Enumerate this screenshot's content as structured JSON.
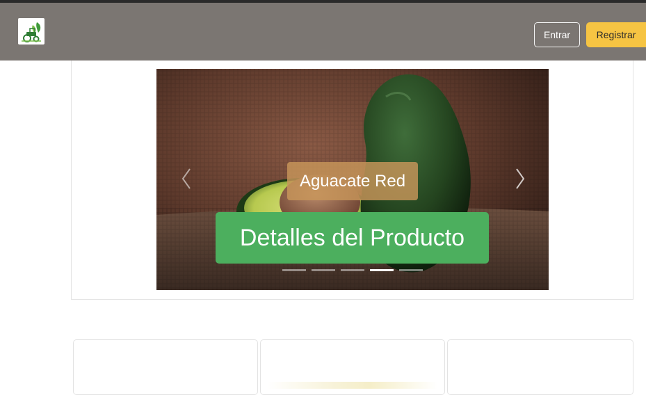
{
  "navbar": {
    "logo_icon": "farm-logo-icon",
    "login_label": "Entrar",
    "register_label": "Registrar",
    "colors": {
      "background": "#7b7672",
      "register_button": "#f6c443"
    }
  },
  "carousel": {
    "caption_title": "Aguacate Red",
    "caption_button": "Detalles del Producto",
    "prev_icon": "chevron-left-icon",
    "next_icon": "chevron-right-icon",
    "slide_count": 5,
    "active_slide": 4,
    "colors": {
      "caption_button": "#4caf5e"
    }
  },
  "product_cards": [
    {
      "name": "card-1"
    },
    {
      "name": "card-2"
    },
    {
      "name": "card-3"
    }
  ]
}
